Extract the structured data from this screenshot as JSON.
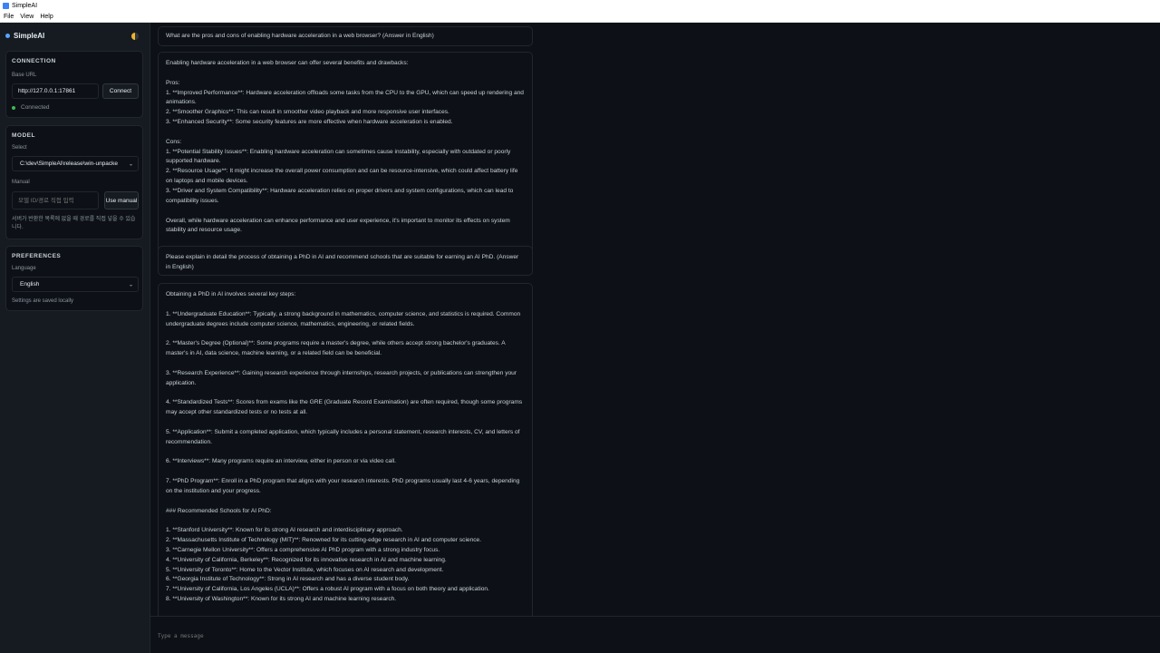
{
  "window": {
    "title": "SimpleAI"
  },
  "menu": {
    "items": [
      "File",
      "View",
      "Help"
    ]
  },
  "sidebar": {
    "brand": "SimpleAI",
    "connection": {
      "title": "CONNECTION",
      "base_url_label": "Base URL",
      "base_url_value": "http://127.0.0.1:17861",
      "connect_label": "Connect",
      "status": "Connected"
    },
    "model": {
      "title": "MODEL",
      "select_label": "Select",
      "selected": "C:\\dev\\SimpleAI\\release\\win-unpacke",
      "manual_label": "Manual",
      "manual_placeholder": "모델 ID/경로 직접 입력",
      "use_manual_label": "Use manual",
      "help": "서버가 반환한 목록에 없을 때 경로를 직접 넣을 수 있습니다."
    },
    "preferences": {
      "title": "PREFERENCES",
      "language_label": "Language",
      "language_value": "English",
      "note": "Settings are saved locally"
    }
  },
  "messages": [
    {
      "role": "user",
      "text": "What are the pros and cons of enabling hardware acceleration in a web browser? (Answer in English)"
    },
    {
      "role": "assistant",
      "text": "Enabling hardware acceleration in a web browser can offer several benefits and drawbacks:\n\nPros:\n1. **Improved Performance**: Hardware acceleration offloads some tasks from the CPU to the GPU, which can speed up rendering and animations.\n2. **Smoother Graphics**: This can result in smoother video playback and more responsive user interfaces.\n3. **Enhanced Security**: Some security features are more effective when hardware acceleration is enabled.\n\nCons:\n1. **Potential Stability Issues**: Enabling hardware acceleration can sometimes cause instability, especially with outdated or poorly supported hardware.\n2. **Resource Usage**: It might increase the overall power consumption and can be resource-intensive, which could affect battery life on laptops and mobile devices.\n3. **Driver and System Compatibility**: Hardware acceleration relies on proper drivers and system configurations, which can lead to compatibility issues.\n\nOverall, while hardware acceleration can enhance performance and user experience, it's important to monitor its effects on system stability and resource usage."
    },
    {
      "role": "user",
      "text": "Please explain in detail the process of obtaining a PhD in AI and recommend schools that are suitable for earning an AI PhD. (Answer in English)"
    },
    {
      "role": "assistant",
      "text": "Obtaining a PhD in AI involves several key steps:\n\n1. **Undergraduate Education**: Typically, a strong background in mathematics, computer science, and statistics is required. Common undergraduate degrees include computer science, mathematics, engineering, or related fields.\n\n2. **Master's Degree (Optional)**: Some programs require a master's degree, while others accept strong bachelor's graduates. A master's in AI, data science, machine learning, or a related field can be beneficial.\n\n3. **Research Experience**: Gaining research experience through internships, research projects, or publications can strengthen your application.\n\n4. **Standardized Tests**: Scores from exams like the GRE (Graduate Record Examination) are often required, though some programs may accept other standardized tests or no tests at all.\n\n5. **Application**: Submit a completed application, which typically includes a personal statement, research interests, CV, and letters of recommendation.\n\n6. **Interviews**: Many programs require an interview, either in person or via video call.\n\n7. **PhD Program**: Enroll in a PhD program that aligns with your research interests. PhD programs usually last 4-6 years, depending on the institution and your progress.\n\n### Recommended Schools for AI PhD:\n\n1. **Stanford University**: Known for its strong AI research and interdisciplinary approach.\n2. **Massachusetts Institute of Technology (MIT)**: Renowned for its cutting-edge research in AI and computer science.\n3. **Carnegie Mellon University**: Offers a comprehensive AI PhD program with a strong industry focus.\n4. **University of California, Berkeley**: Recognized for its innovative research in AI and machine learning.\n5. **University of Toronto**: Home to the Vector Institute, which focuses on AI research and development.\n6. **Georgia Institute of Technology**: Strong in AI research and has a diverse student body.\n7. **University of California, Los Angeles (UCLA)**: Offers a robust AI program with a focus on both theory and application.\n8. **University of Washington**: Known for its strong AI and machine learning research."
    }
  ],
  "composer": {
    "placeholder": "Type a message"
  }
}
